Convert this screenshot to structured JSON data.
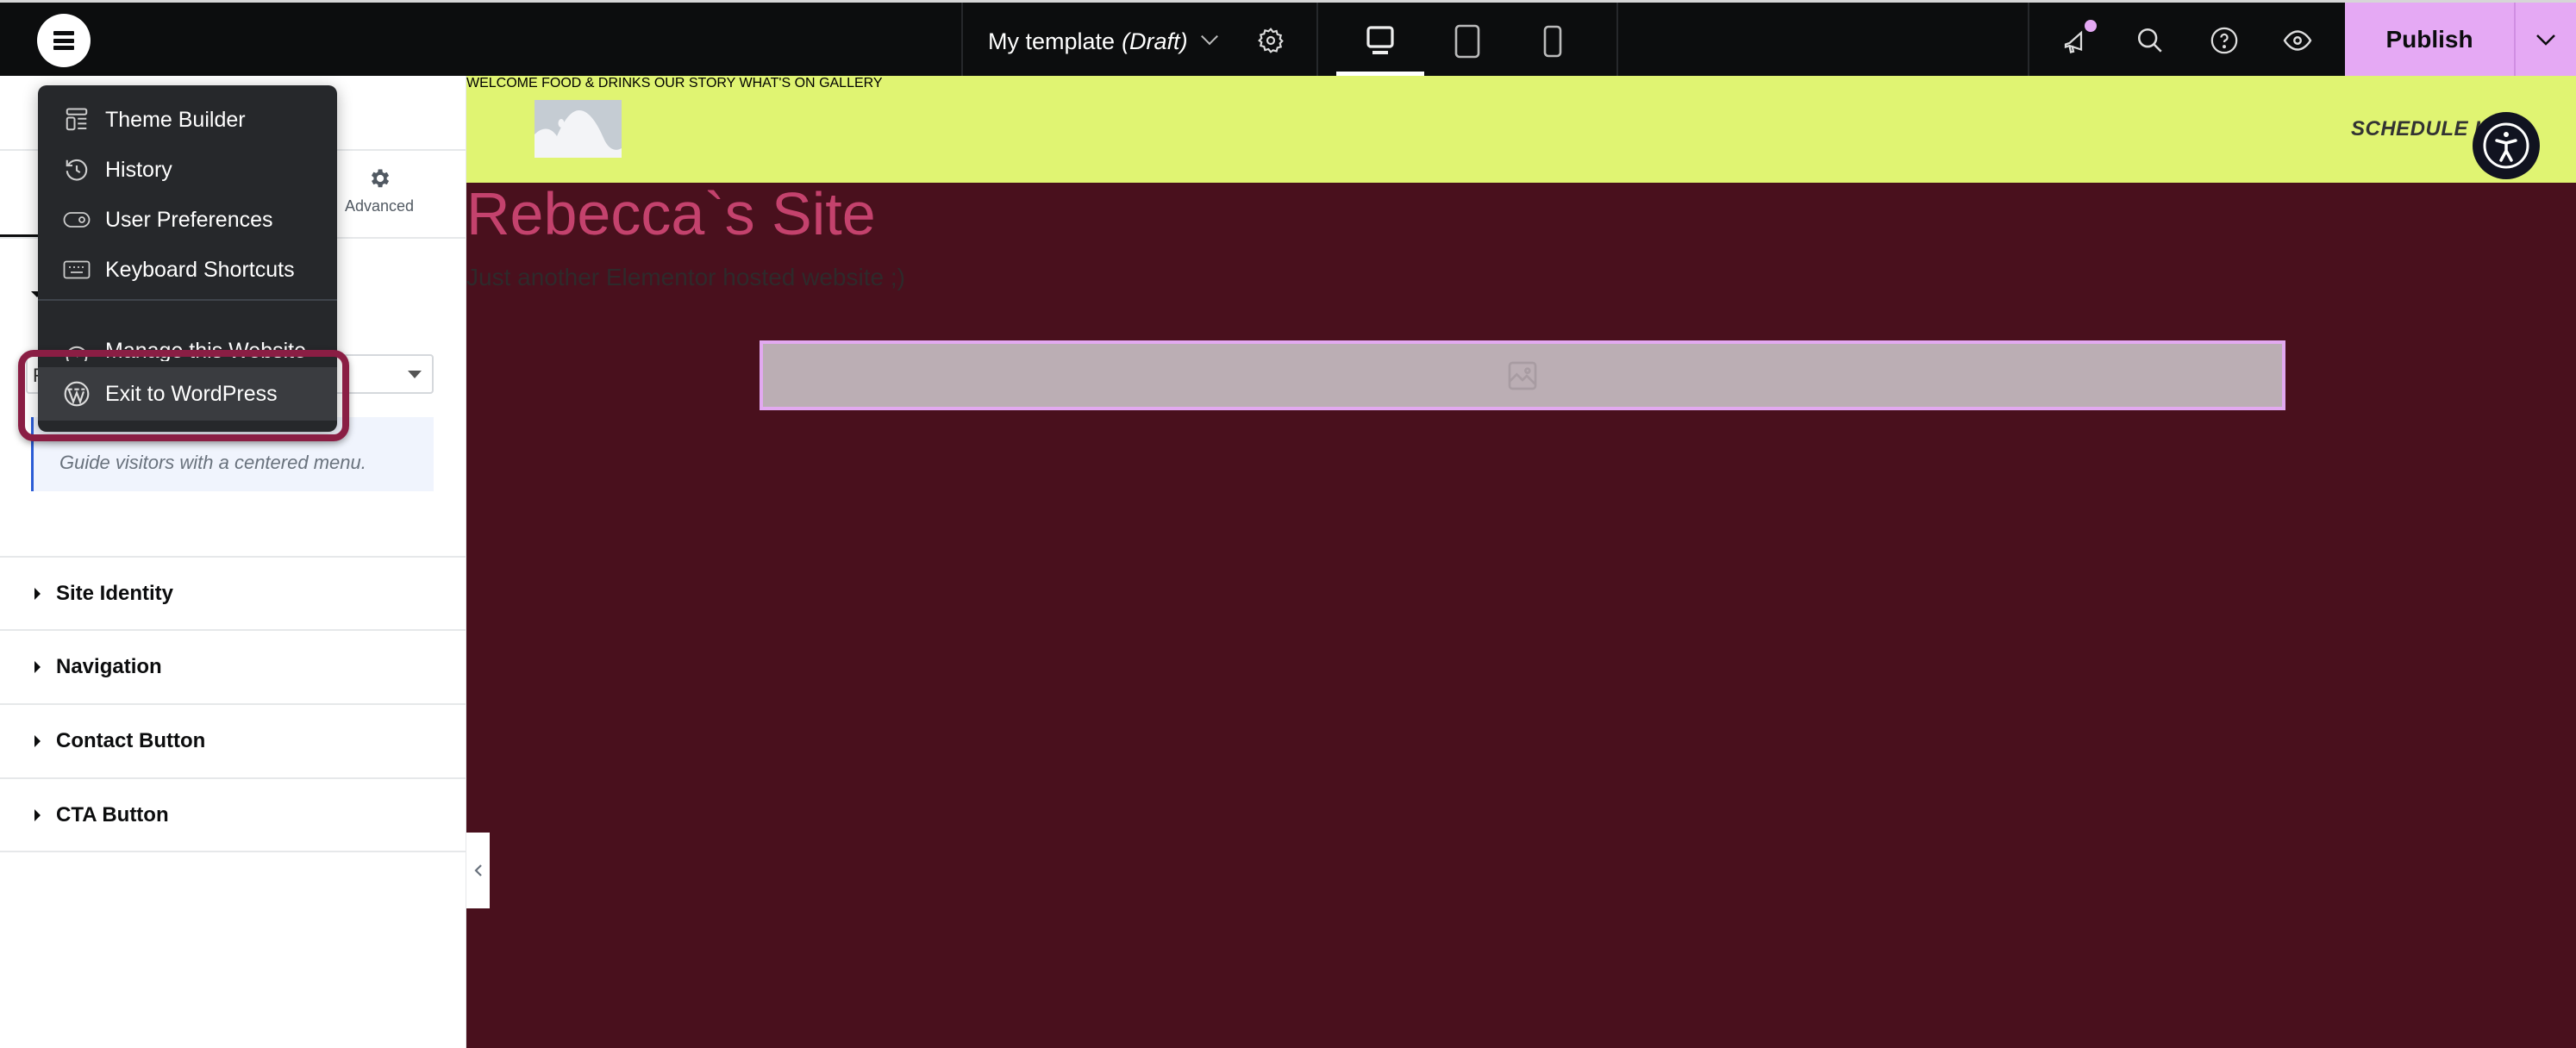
{
  "topbar": {
    "menu_icon": "hamburger-icon",
    "document_title": "My template",
    "document_status": "(Draft)",
    "page_settings_icon": "gear-icon",
    "devices": [
      {
        "name": "desktop",
        "icon": "desktop-icon",
        "active": true
      },
      {
        "name": "tablet",
        "icon": "tablet-icon",
        "active": false
      },
      {
        "name": "mobile",
        "icon": "mobile-icon",
        "active": false
      }
    ],
    "right_icons": [
      "megaphone-icon",
      "search-icon",
      "help-icon",
      "preview-eye-icon"
    ],
    "notification_dot_color": "#e5a9f4",
    "publish_label": "Publish",
    "publish_color": "#e5a9f4"
  },
  "main_menu": {
    "items": [
      {
        "label": "Theme Builder",
        "icon": "theme-builder-icon"
      },
      {
        "label": "History",
        "icon": "history-icon"
      },
      {
        "label": "User Preferences",
        "icon": "toggle-icon"
      },
      {
        "label": "Keyboard Shortcuts",
        "icon": "keyboard-icon"
      },
      {
        "label": "Manage this Website",
        "icon": "dashboard-icon"
      },
      {
        "label": "Exit to WordPress",
        "icon": "wordpress-icon",
        "highlighted": true
      }
    ]
  },
  "panel": {
    "tab_advanced_label": "Advanced",
    "select_value": "F",
    "info_text": "Guide visitors with a centered menu.",
    "sections": [
      {
        "label": "Site Identity"
      },
      {
        "label": "Navigation"
      },
      {
        "label": "Contact Button"
      },
      {
        "label": "CTA Button"
      }
    ]
  },
  "site": {
    "header_color": "#e0f472",
    "background_color": "#49101d",
    "nav": [
      "WELCOME",
      "FOOD & DRINKS",
      "OUR STORY",
      "WHAT'S ON",
      "GALLERY"
    ],
    "cta_label": "SCHEDULE NOW",
    "title": "Rebecca`s Site",
    "title_color": "#c4426d",
    "tagline": "Just another Elementor hosted website ;)"
  }
}
